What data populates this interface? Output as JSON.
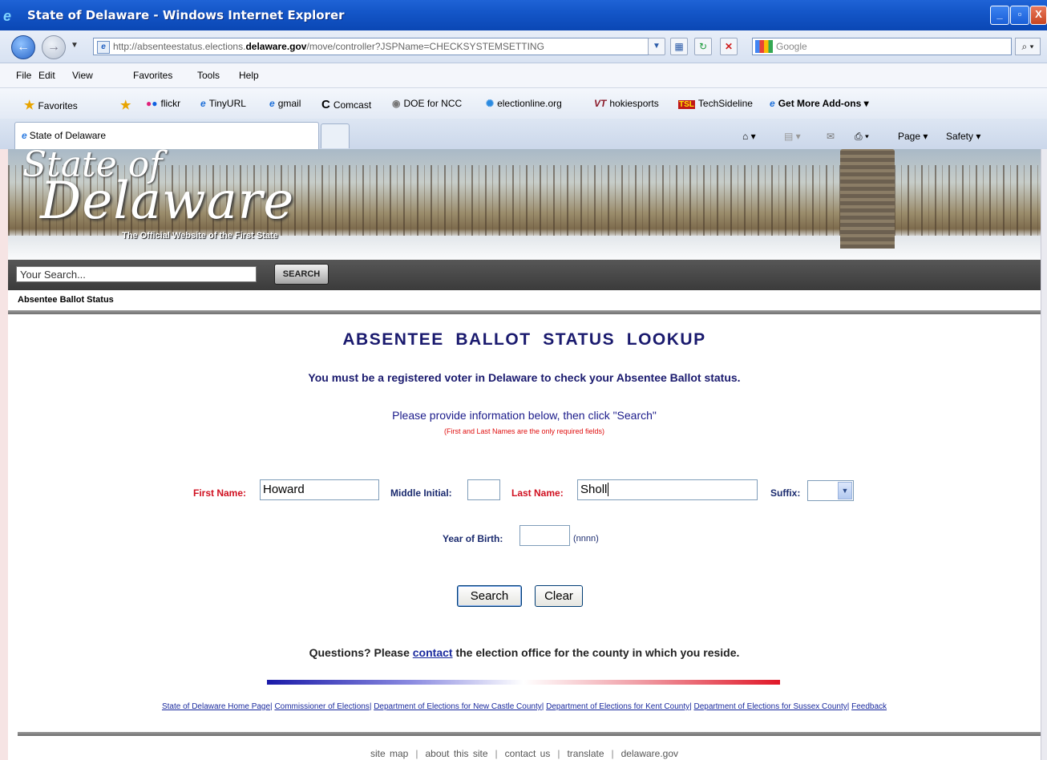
{
  "window": {
    "title": "State of Delaware - Windows Internet Explorer"
  },
  "address": {
    "url_prefix": "http://absenteestatus.elections.",
    "url_domain": "delaware.gov",
    "url_path": "/move/controller?JSPName=CHECKSYSTEMSETTING",
    "search_provider": "Google"
  },
  "menu": [
    "File",
    "Edit",
    "View",
    "Favorites",
    "Tools",
    "Help"
  ],
  "favorites": {
    "label": "Favorites",
    "items": [
      "flickr",
      "TinyURL",
      "gmail",
      "Comcast",
      "DOE for NCC",
      "electionline.org",
      "hokiesports",
      "TechSideline",
      "Get More Add-ons"
    ]
  },
  "tab": {
    "title": "State of Delaware"
  },
  "commandbar": {
    "page": "Page",
    "safety": "Safety"
  },
  "banner": {
    "logo_line1": "State of",
    "logo_line2": "Delaware",
    "tagline": "The Official Website of the First State"
  },
  "site_search": {
    "placeholder": "Your Search...",
    "button": "SEARCH"
  },
  "breadcrumb": "Absentee Ballot Status",
  "lookup": {
    "title": "ABSENTEE  BALLOT  STATUS  LOOKUP",
    "subtitle": "You must be a registered voter in Delaware to check your Absentee Ballot status.",
    "instructions": "Please provide information below, then click \"Search\"",
    "required_note": "(First and Last Names are the only required fields)",
    "first_name_label": "First Name:",
    "first_name_value": "Howard",
    "middle_initial_label": "Middle Initial:",
    "middle_initial_value": "",
    "last_name_label": "Last Name:",
    "last_name_value": "Sholl",
    "suffix_label": "Suffix:",
    "suffix_value": "",
    "yob_label": "Year of Birth:",
    "yob_value": "",
    "yob_hint": "(nnnn)",
    "search_button": "Search",
    "clear_button": "Clear"
  },
  "questions": {
    "before": "Questions? Please ",
    "link": "contact",
    "after": " the election office for the county in which you reside."
  },
  "footer_links": [
    "State of Delaware Home Page",
    "Commissioner of Elections",
    "Department of Elections for New Castle County",
    "Department of Elections for Kent County",
    "Department of Elections for Sussex County",
    "Feedback"
  ],
  "site_footer": [
    "site map",
    "about this site",
    "contact us",
    "translate",
    "delaware.gov"
  ]
}
